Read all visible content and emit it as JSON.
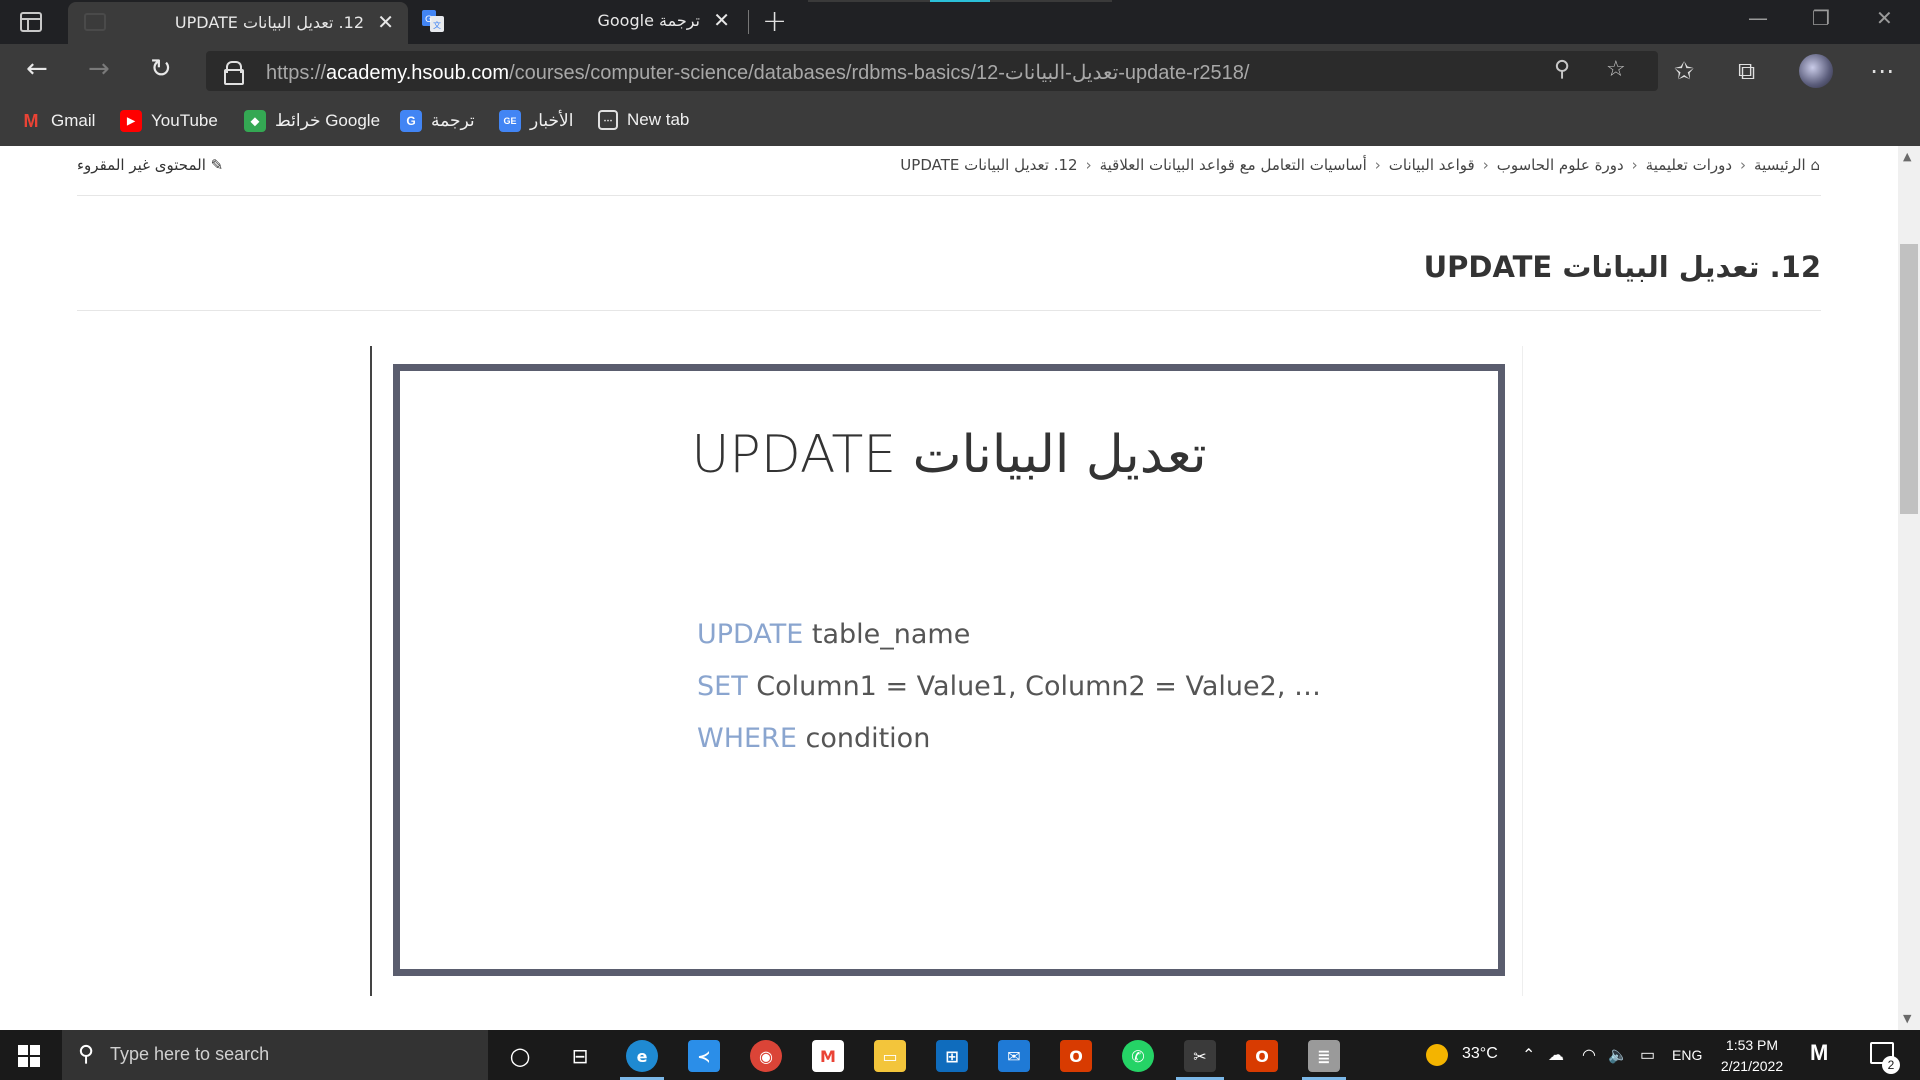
{
  "browser": {
    "tabs": [
      {
        "title": "12. تعديل البيانات UPDATE",
        "active": true
      },
      {
        "title": "ترجمة Google",
        "active": false
      }
    ],
    "url_scheme": "https://",
    "url_host": "academy.hsoub.com",
    "url_path": "/courses/computer-science/databases/rdbms-basics/12-تعديل-البيانات-update-r2518/",
    "bookmarks": [
      "Gmail",
      "YouTube",
      "خرائط Google",
      "ترجمة",
      "الأخبار",
      "New tab"
    ]
  },
  "page": {
    "breadcrumb": [
      "الرئيسية",
      "دورات تعليمية",
      "دورة علوم الحاسوب",
      "قواعد البيانات",
      "أساسيات التعامل مع قواعد البيانات العلاقية",
      "12. تعديل البيانات UPDATE"
    ],
    "unread_label": "المحتوى غير المقروء",
    "title": "12. تعديل البيانات UPDATE",
    "slide": {
      "title": "تعديل البيانات UPDATE",
      "code_lines": [
        {
          "keyword": "UPDATE",
          "rest": " table_name"
        },
        {
          "keyword": "SET",
          "rest": " Column1 = Value1, Column2 = Value2, …"
        },
        {
          "keyword": "WHERE",
          "rest": " condition"
        }
      ]
    }
  },
  "taskbar": {
    "search_placeholder": "Type here to search",
    "temperature": "33°C",
    "language": "ENG",
    "time": "1:53 PM",
    "date": "2/21/2022",
    "notification_count": "2"
  },
  "colors": {
    "keyword": "#8aa5cf",
    "slide_border": "#5a5d6e",
    "chrome_dark": "#202124",
    "toolbar": "#3b3b3b"
  }
}
